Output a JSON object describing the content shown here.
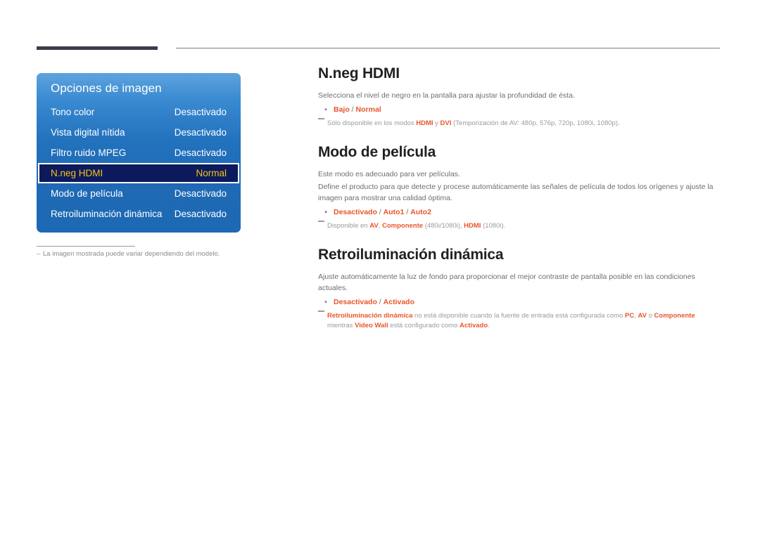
{
  "osd": {
    "title": "Opciones de imagen",
    "rows": [
      {
        "label": "Tono color",
        "value": "Desactivado",
        "selected": false
      },
      {
        "label": "Vista digital nítida",
        "value": "Desactivado",
        "selected": false
      },
      {
        "label": "Filtro ruido MPEG",
        "value": "Desactivado",
        "selected": false
      },
      {
        "label": "N.neg HDMI",
        "value": "Normal",
        "selected": true
      },
      {
        "label": "Modo de película",
        "value": "Desactivado",
        "selected": false
      },
      {
        "label": "Retroiluminación dinámica",
        "value": "Desactivado",
        "selected": false
      }
    ],
    "footnote_dash": "–",
    "footnote": "La imagen mostrada puede variar dependiendo del modelo."
  },
  "sections": [
    {
      "title": "N.neg HDMI",
      "para1": "Selecciona el nivel de negro en la pantalla para ajustar la profundidad de ésta.",
      "bullet_dot": "•",
      "bullet": {
        "opt1": "Bajo",
        "sep1": " / ",
        "opt2": "Normal"
      },
      "note": {
        "t1": "Sólo disponible en los modos ",
        "b1": "HDMI",
        "t2": " y ",
        "b2": "DVI",
        "t3": " (Temporización de AV: 480p, 576p, 720p, 1080i, 1080p)."
      }
    },
    {
      "title": "Modo de película",
      "para1": "Este modo es adecuado para ver películas.",
      "para2": "Define el producto para que detecte y procese automáticamente las señales de película de todos los orígenes y ajuste la imagen para mostrar una calidad óptima.",
      "bullet_dot": "•",
      "bullet": {
        "opt1": "Desactivado",
        "sep1": " / ",
        "opt2": "Auto1",
        "sep2": " / ",
        "opt3": "Auto2"
      },
      "note": {
        "t1": "Disponible en ",
        "b1": "AV",
        "t2": ", ",
        "b2": "Componente",
        "t3": " (480i/1080i), ",
        "b3": "HDMI",
        "t4": " (1080i)."
      }
    },
    {
      "title": "Retroiluminación dinámica",
      "para1": "Ajuste automáticamente la luz de fondo para proporcionar el mejor contraste de pantalla posible en las condiciones actuales.",
      "bullet_dot": "•",
      "bullet": {
        "opt1": "Desactivado",
        "sep1": " / ",
        "opt2": "Activado"
      },
      "note": {
        "b1": "Retroiluminación dinámica",
        "t1": " no está disponible cuando la fuente de entrada está configurada como ",
        "b2": "PC",
        "t2": ", ",
        "b3": "AV",
        "t3": " o ",
        "b4": "Componente",
        "t4": " mientras ",
        "b5": "Video Wall",
        "t5": " está configurado como ",
        "b6": "Activado",
        "t6": "."
      }
    }
  ],
  "colors": {
    "accent_orange": "#e8562a",
    "osd_blue": "#1e69b4",
    "osd_selected_bg": "#0c1a5c",
    "osd_selected_text": "#f3c41c",
    "body_gray": "#6d6e71",
    "note_gray": "#9a9aa2",
    "rule_dark": "#3f3c4b"
  }
}
